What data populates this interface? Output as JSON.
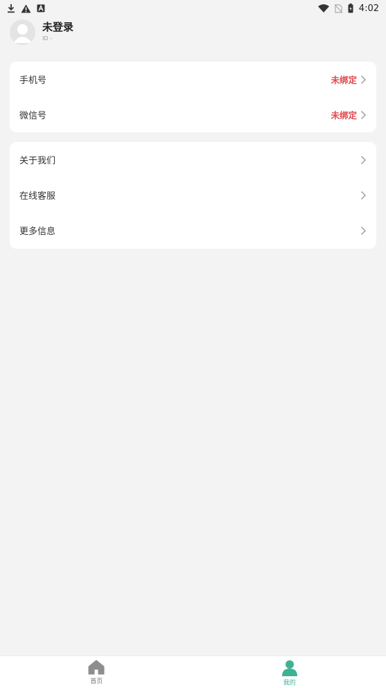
{
  "status_bar": {
    "time": "4:02",
    "left_icons": [
      "download-icon",
      "warning-icon",
      "notification-a-icon"
    ],
    "right_icons": [
      "wifi-icon",
      "no-sim-icon",
      "battery-icon"
    ]
  },
  "profile": {
    "name": "未登录",
    "id_text": "ID -"
  },
  "account_card": {
    "items": [
      {
        "label": "手机号",
        "value": "未绑定"
      },
      {
        "label": "微信号",
        "value": "未绑定"
      }
    ]
  },
  "info_card": {
    "items": [
      {
        "label": "关于我们"
      },
      {
        "label": "在线客服"
      },
      {
        "label": "更多信息"
      }
    ]
  },
  "tab_bar": {
    "tabs": [
      {
        "label": "首页",
        "icon": "home-icon",
        "active": false
      },
      {
        "label": "我的",
        "icon": "user-icon",
        "active": true
      }
    ]
  },
  "colors": {
    "accent": "#3db394",
    "warning_value": "#e0474e",
    "background": "#f3f3f3",
    "card": "#ffffff"
  }
}
